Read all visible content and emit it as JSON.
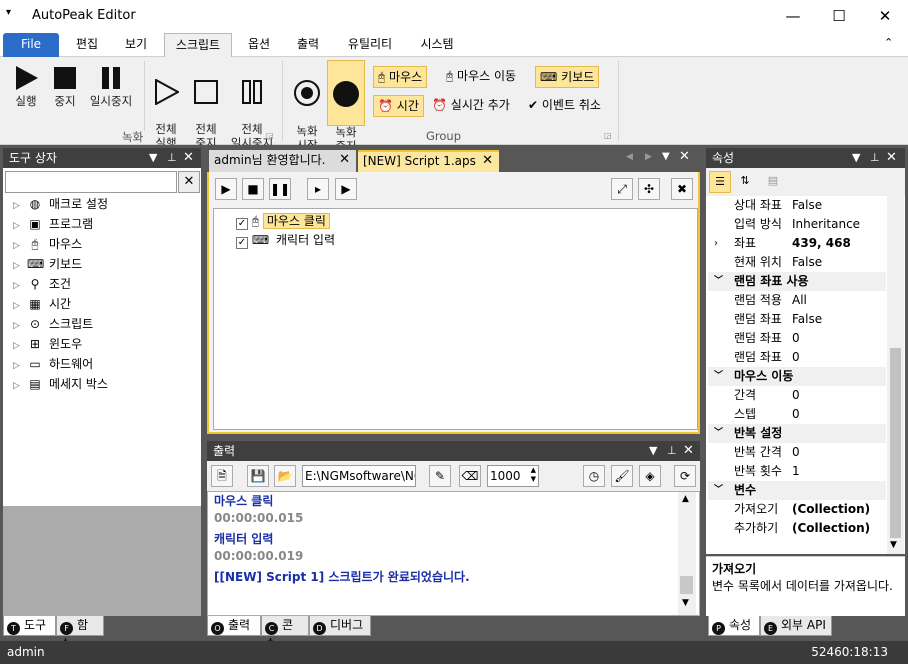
{
  "window": {
    "title": "AutoPeak Editor"
  },
  "menu": {
    "tabs": [
      "File",
      "편집",
      "보기",
      "스크립트",
      "옵션",
      "출력",
      "유틸리티",
      "시스템"
    ],
    "active": "스크립트"
  },
  "ribbon": {
    "record_group": {
      "label": "녹화",
      "buttons": [
        "실행",
        "중지",
        "일시중지",
        "전체\n실행",
        "전체\n중지",
        "전체\n일시중지"
      ]
    },
    "group": {
      "label": "Group",
      "big_buttons": [
        "녹화\n시작",
        "녹화\n중지"
      ],
      "mouse": "마우스",
      "mouse_move": "마우스 이동",
      "keyboard": "키보드",
      "time": "시간",
      "realtime_add": "실시간 추가",
      "event_cancel": "이벤트 취소"
    }
  },
  "toolbox": {
    "title": "도구 상자",
    "items": [
      {
        "label": "매크로 설정",
        "icon": "globe-icon"
      },
      {
        "label": "프로그램",
        "icon": "program-icon"
      },
      {
        "label": "마우스",
        "icon": "mouse-icon"
      },
      {
        "label": "키보드",
        "icon": "keyboard-icon"
      },
      {
        "label": "조건",
        "icon": "condition-icon"
      },
      {
        "label": "시간",
        "icon": "calendar-icon"
      },
      {
        "label": "스크립트",
        "icon": "script-icon"
      },
      {
        "label": "윈도우",
        "icon": "windows-icon"
      },
      {
        "label": "하드웨어",
        "icon": "laptop-icon"
      },
      {
        "label": "메세지 박스",
        "icon": "message-icon"
      }
    ],
    "bottom_tabs": [
      {
        "letter": "T",
        "label": "도구"
      },
      {
        "letter": "F",
        "label": "함수"
      }
    ]
  },
  "document": {
    "tabs": [
      "admin님 환영합니다.",
      "[NEW] Script 1.aps"
    ],
    "active": "[NEW] Script 1.aps",
    "script_items": [
      {
        "label": "마우스 클릭",
        "checked": true,
        "selected": true
      },
      {
        "label": "캐릭터 입력",
        "checked": true,
        "selected": false
      }
    ]
  },
  "output": {
    "title": "출력",
    "path": "E:\\NGMsoftware\\NG",
    "number": "1000",
    "lines": [
      {
        "text": "마우스 클릭",
        "color": "#1a2ea8"
      },
      {
        "text": "00:00:00.015",
        "color": "#888888"
      },
      {
        "text": "캐릭터 입력",
        "color": "#1a2ea8"
      },
      {
        "text": "00:00:00.019",
        "color": "#888888"
      },
      {
        "text": "[[NEW] Script 1] 스크립트가 완료되었습니다.",
        "color": "#1a2ea8"
      }
    ],
    "bottom_tabs": [
      {
        "letter": "O",
        "label": "출력"
      },
      {
        "letter": "C",
        "label": "콘솔"
      },
      {
        "letter": "D",
        "label": "디버그"
      }
    ]
  },
  "properties": {
    "title": "속성",
    "rows": [
      {
        "type": "prop",
        "name": "상대 좌표",
        "value": "False"
      },
      {
        "type": "prop",
        "name": "입력 방식",
        "value": "Inheritance"
      },
      {
        "type": "prop",
        "name": "좌표",
        "value": "439, 468",
        "expand": true,
        "bold": true
      },
      {
        "type": "prop",
        "name": "현재 위치",
        "value": "False"
      },
      {
        "type": "cat",
        "name": "랜덤 좌표 사용"
      },
      {
        "type": "prop",
        "name": "랜덤 적용",
        "value": "All"
      },
      {
        "type": "prop",
        "name": "랜덤 좌표",
        "value": "False"
      },
      {
        "type": "prop",
        "name": "랜덤 좌표",
        "value": "0"
      },
      {
        "type": "prop",
        "name": "랜덤 좌표",
        "value": "0"
      },
      {
        "type": "cat",
        "name": "마우스 이동"
      },
      {
        "type": "prop",
        "name": "간격",
        "value": "0"
      },
      {
        "type": "prop",
        "name": "스텝",
        "value": "0"
      },
      {
        "type": "cat",
        "name": "반복 설정"
      },
      {
        "type": "prop",
        "name": "반복 간격",
        "value": "0"
      },
      {
        "type": "prop",
        "name": "반복 횟수",
        "value": "1"
      },
      {
        "type": "cat",
        "name": "변수"
      },
      {
        "type": "prop",
        "name": "가져오기",
        "value": "(Collection)",
        "bold": true
      },
      {
        "type": "prop",
        "name": "추가하기",
        "value": "(Collection)",
        "bold": true
      }
    ],
    "desc_title": "가져오기",
    "desc_text": "변수 목록에서 데이터를 가져옵니다.",
    "bottom_tabs": [
      {
        "letter": "P",
        "label": "속성"
      },
      {
        "letter": "E",
        "label": "외부 API"
      }
    ]
  },
  "statusbar": {
    "user": "admin",
    "right": "52460:18:13"
  }
}
